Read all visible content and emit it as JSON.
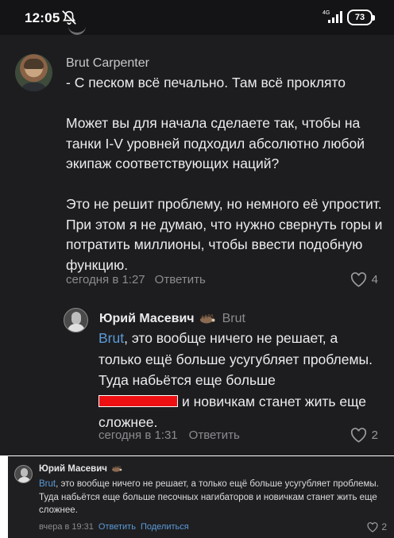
{
  "status_bar": {
    "time": "12:05",
    "network": "4G",
    "battery": "73"
  },
  "main_comment": {
    "author": "Brut Carpenter",
    "paragraphs": [
      "- С песком всё печально. Там всё проклято",
      "Может вы для начала сделаете так, чтобы на танки I-V уровней подходил абсолютно любой экипаж соответствующих наций?",
      "Это не решит проблему, но немного её упростит. При этом я не думаю, что нужно свернуть горы и потратить миллионы, чтобы ввести подобную функцию."
    ],
    "time": "сегодня в 1:27",
    "reply_label": "Ответить",
    "likes": "4"
  },
  "reply_comment": {
    "author": "Юрий Масевич",
    "reply_to": "Brut",
    "mention": "Brut",
    "text_part1": ", это вообще ничего не решает, а только ещё больше усугубляет проблемы. Туда набьётся еще больше",
    "text_part2": "и новичкам станет жить еще сложнее.",
    "time": "сегодня в 1:31",
    "reply_label": "Ответить",
    "likes": "2"
  },
  "desktop_comment": {
    "author": "Юрий Масевич",
    "mention": "Brut",
    "text": ", это вообще ничего не решает, а только ещё больше усугубляет проблемы. Туда набьётся еще больше песочных нагибаторов и новичкам станет жить еще сложнее.",
    "time": "вчера в 19:31",
    "reply_label": "Ответить",
    "share_label": "Поделиться",
    "likes": "2"
  },
  "colors": {
    "link": "#5b9ad8",
    "redaction": "#ee0f12",
    "background": "#1d1d1f"
  },
  "icons": [
    "mute-icon",
    "signal-icon",
    "heart-icon",
    "hedgehog-badge-icon"
  ]
}
